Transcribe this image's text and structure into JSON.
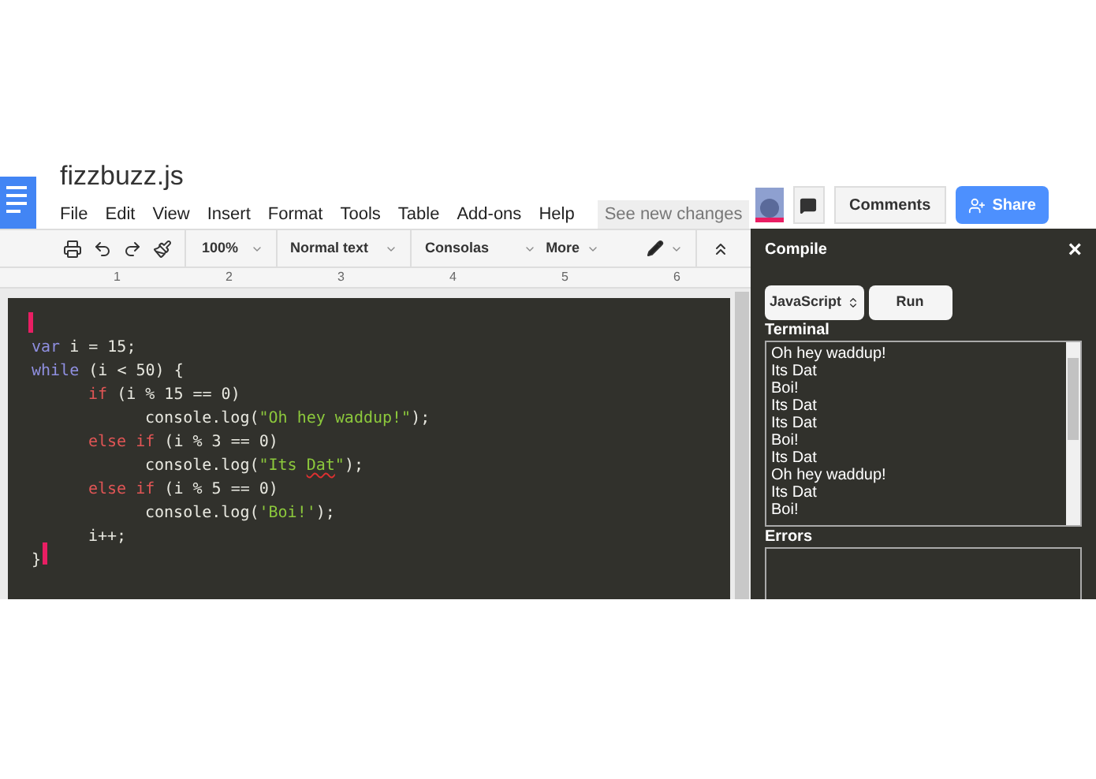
{
  "document": {
    "title": "fizzbuzz.js",
    "menu": [
      "File",
      "Edit",
      "View",
      "Insert",
      "Format",
      "Tools",
      "Table",
      "Add-ons",
      "Help"
    ],
    "changes_button": "See new changes"
  },
  "header_buttons": {
    "comments": "Comments",
    "share": "Share"
  },
  "toolbar": {
    "zoom": "100%",
    "style": "Normal text",
    "font": "Consolas",
    "more": "More"
  },
  "ruler": [
    "1",
    "2",
    "3",
    "4",
    "5",
    "6"
  ],
  "code": [
    {
      "tokens": [
        {
          "kind": "decl",
          "text": "var"
        },
        {
          "kind": "plain",
          "text": " i = 15;"
        }
      ]
    },
    {
      "tokens": [
        {
          "kind": "decl",
          "text": "while"
        },
        {
          "kind": "plain",
          "text": " (i < 50) {"
        }
      ],
      "children": [
        {
          "tokens": [
            {
              "kind": "keyword",
              "text": "if"
            },
            {
              "kind": "plain",
              "text": " (i % 15 == 0)"
            }
          ],
          "children": [
            {
              "tokens": [
                {
                  "kind": "plain",
                  "text": "console.log("
                },
                {
                  "kind": "string",
                  "text": "\"Oh hey waddup!\""
                },
                {
                  "kind": "plain",
                  "text": ");"
                }
              ]
            }
          ]
        },
        {
          "tokens": [
            {
              "kind": "keyword",
              "text": "else if"
            },
            {
              "kind": "plain",
              "text": " (i % 3 == 0)"
            }
          ],
          "children": [
            {
              "tokens": [
                {
                  "kind": "plain",
                  "text": "console.log("
                },
                {
                  "kind": "string",
                  "text": "\"Its "
                },
                {
                  "kind": "misspelled",
                  "text": "Dat"
                },
                {
                  "kind": "string",
                  "text": "\""
                },
                {
                  "kind": "plain",
                  "text": ");"
                }
              ]
            }
          ]
        },
        {
          "tokens": [
            {
              "kind": "keyword",
              "text": "else if"
            },
            {
              "kind": "plain",
              "text": " (i % 5 == 0)"
            }
          ],
          "children": [
            {
              "tokens": [
                {
                  "kind": "plain",
                  "text": "console.log("
                },
                {
                  "kind": "string",
                  "text": "'Boi!'"
                },
                {
                  "kind": "plain",
                  "text": ");"
                }
              ]
            }
          ]
        },
        {
          "tokens": [
            {
              "kind": "plain",
              "text": "i++;"
            }
          ]
        }
      ]
    },
    {
      "tokens": [
        {
          "kind": "plain",
          "text": "}"
        }
      ]
    }
  ],
  "compile_panel": {
    "title": "Compile",
    "close": "×",
    "language": "JavaScript",
    "run": "Run",
    "terminal_label": "Terminal",
    "terminal": [
      "Oh hey waddup!",
      "Its Dat",
      "Boi!",
      "Its Dat",
      "Its Dat",
      "Boi!",
      "Its Dat",
      "Oh hey waddup!",
      "Its Dat",
      "Boi!"
    ],
    "errors_label": "Errors"
  }
}
